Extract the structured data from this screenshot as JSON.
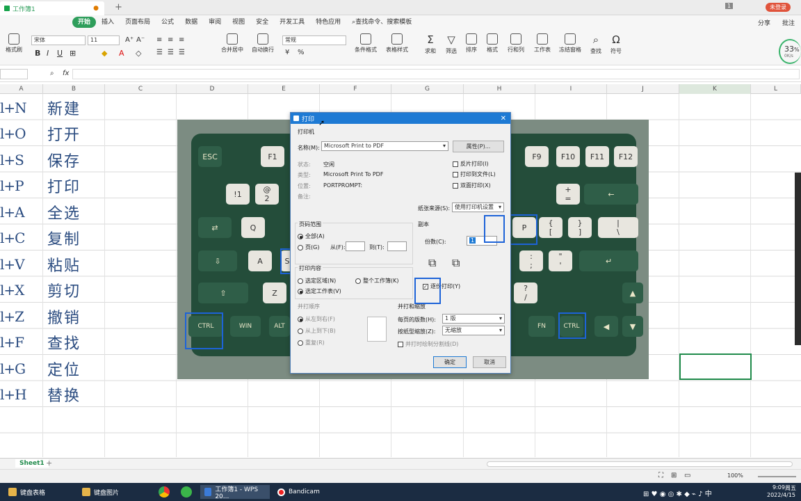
{
  "titlebar": {
    "doc_name": "工作簿1",
    "badge_num": "1",
    "user_label": "未登录"
  },
  "menus": [
    "开始",
    "插入",
    "页面布局",
    "公式",
    "数据",
    "审阅",
    "视图",
    "安全",
    "开发工具",
    "特色应用",
    "查找命令、搜索模板"
  ],
  "menu_right": {
    "share": "分享",
    "comment": "批注"
  },
  "toolbar": {
    "font": "宋体",
    "size": "11",
    "number_format": "常规",
    "labels": [
      "格式刷",
      "合并居中",
      "自动换行",
      "条件格式",
      "表格样式",
      "求和",
      "筛选",
      "排序",
      "格式",
      "行和列",
      "工作表",
      "冻结窗格",
      "查找",
      "符号"
    ]
  },
  "speed": {
    "percent": "33",
    "unit": "%",
    "rate": "0K/s"
  },
  "formulabar": {
    "fx": "fx"
  },
  "columns": [
    "A",
    "B",
    "C",
    "D",
    "E",
    "F",
    "G",
    "H",
    "I",
    "J",
    "K",
    "L"
  ],
  "rows": [
    {
      "key": "l+N",
      "val": "新建"
    },
    {
      "key": "l+O",
      "val": "打开"
    },
    {
      "key": "l+S",
      "val": "保存"
    },
    {
      "key": "l+P",
      "val": "打印"
    },
    {
      "key": "l+A",
      "val": "全选"
    },
    {
      "key": "l+C",
      "val": "复制"
    },
    {
      "key": "l+V",
      "val": "粘贴"
    },
    {
      "key": "l+X",
      "val": "剪切"
    },
    {
      "key": "l+Z",
      "val": "撤销"
    },
    {
      "key": "l+F",
      "val": "查找"
    },
    {
      "key": "l+G",
      "val": "定位"
    },
    {
      "key": "l+H",
      "val": "替换"
    }
  ],
  "keys": {
    "esc": "ESC",
    "f1": "F1",
    "f9": "F9",
    "f10": "F10",
    "f11": "F11",
    "f12": "F12",
    "q": "Q",
    "a": "A",
    "z": "Z",
    "s": "S",
    "p": "P",
    "ctrl": "CTRL",
    "win": "WIN",
    "alt": "ALT",
    "fn": "FN",
    "ctrl2": "CTRL",
    "excl": "!",
    "one": "1",
    "at": "@",
    "two": "2",
    "plus": "+",
    "eq": "=",
    "brace_l": "{",
    "bracket_l": "[",
    "brace_r": "}",
    "bracket_r": "]",
    "pipe": "|",
    "bslash": "\\",
    "colon": ":",
    "semi": ";",
    "quote": "\"",
    "apos": "'",
    "qmark": "?",
    "slash": "/"
  },
  "dialog": {
    "title": "打印",
    "printer_section": "打印机",
    "name_label": "名称(M):",
    "name_value": "Microsoft Print to PDF",
    "properties": "属性(P)...",
    "status_label": "状态:",
    "status_value": "空闲",
    "type_label": "类型:",
    "type_value": "Microsoft Print To PDF",
    "location_label": "位置:",
    "location_value": "PORTPROMPT:",
    "comment_label": "备注:",
    "reverse": "反片打印(I)",
    "to_file": "打印到文件(L)",
    "duplex": "双面打印(X)",
    "paper_source_label": "纸张来源(S):",
    "paper_source_value": "使用打印机设置",
    "range_section": "页码范围",
    "all": "全部(A)",
    "pages": "页(G)",
    "from": "从(F):",
    "to": "到(T):",
    "copies_section": "副本",
    "copies_label": "份数(C):",
    "copies_value": "1",
    "content_section": "打印内容",
    "selection": "选定区域(N)",
    "whole_book": "整个工作簿(K)",
    "selected_sheet": "选定工作表(V)",
    "collate": "逐份打印(Y)",
    "order_section": "并打顺序",
    "left_to_right": "从左到右(F)",
    "top_to_bottom": "从上到下(B)",
    "repeat": "重复(R)",
    "merge_section": "并打和缩放",
    "per_page_label": "每页的版数(H):",
    "per_page_value": "1 版",
    "scale_label": "按纸型缩放(Z):",
    "scale_value": "无缩放",
    "merge_lines": "并打时绘制分割线(D)",
    "ok": "确定",
    "cancel": "取消"
  },
  "sheet": {
    "tab": "Sheet1",
    "add": "+"
  },
  "status": {
    "zoom": "100%"
  },
  "taskbar": {
    "items": [
      "键盘表格",
      "键盘图片",
      "工作簿1 - WPS 20...",
      "Bandicam"
    ],
    "time": "9:09",
    "date": "2022/4/15",
    "weekday": "周五"
  }
}
